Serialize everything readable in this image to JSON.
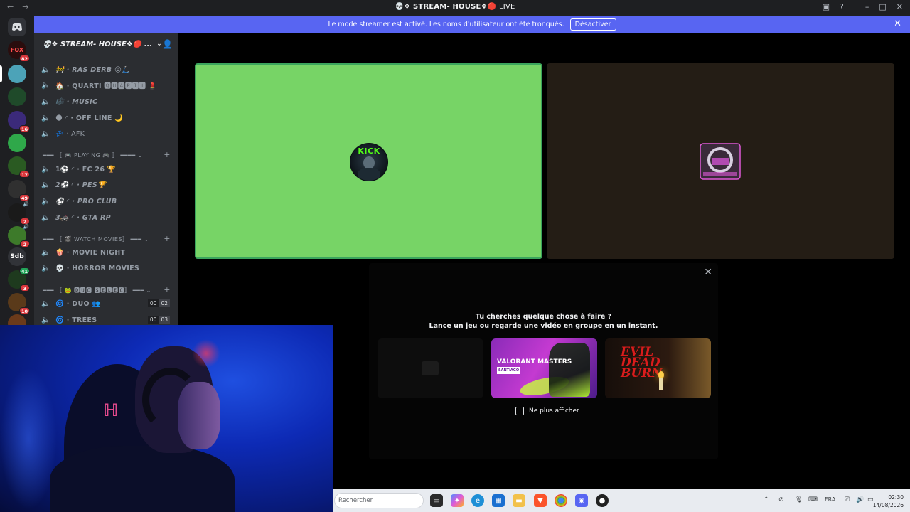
{
  "titlebar": {
    "back": "←",
    "forward": "→",
    "title": "💀❖ STREAM- HOUSE❖🔴",
    "live": "LIVE",
    "icons": [
      "inbox-icon",
      "help-icon",
      "minimize-icon",
      "maximize-icon",
      "close-icon"
    ]
  },
  "banner": {
    "message": "Le mode streamer est activé. Les noms d'utilisateur ont été tronqués.",
    "button": "Désactiver",
    "close": "✕"
  },
  "rail": {
    "servers": [
      {
        "label": "FOX",
        "badge": "82"
      },
      {
        "label": "",
        "badge": ""
      },
      {
        "label": "",
        "badge": ""
      },
      {
        "label": "",
        "badge": "16"
      },
      {
        "label": "",
        "badge": ""
      },
      {
        "label": "",
        "badge": "17"
      },
      {
        "label": "",
        "badge": "49"
      },
      {
        "label": "",
        "badge": "2"
      },
      {
        "label": "",
        "badge": "2"
      },
      {
        "label": "Sdb",
        "badge": ""
      },
      {
        "label": "",
        "badge": "3"
      },
      {
        "label": "",
        "badge": "10"
      }
    ],
    "extra_badge": "41"
  },
  "sidebar": {
    "guild_name": "💀❖ STREAM- HOUSE❖🔴 ...",
    "channels_top": [
      {
        "label": "🚧 · RAS DERB 😵🛴"
      },
      {
        "label": "🏠 · QUARTI 🆀🆄🅰🆁🆃🅸 💄"
      },
      {
        "label": "🎼 · MUSIC"
      },
      {
        "label": "🌑 ◜ · OFF LINE 🌙"
      },
      {
        "label": "💤 · AFK"
      }
    ],
    "cat_playing": "━━━ 〚 🎮 PLAYING 🎮 〛 ━━━━ ⌄",
    "channels_playing": [
      {
        "label": "1⚽ ◜ · FC 26 🏆"
      },
      {
        "label": "2⚽ ◜ · PES🏆"
      },
      {
        "label": "⚽ ◜ · PRO CLUB"
      },
      {
        "label": "3🚓 ◜ · GTA RP"
      }
    ],
    "cat_movies": "━━━ 〚 🎬 WATCH MOVIES〛 ━━━ ⌄",
    "channels_movies": [
      {
        "label": "🍿 · MOVIE NIGHT"
      },
      {
        "label": "💀 · HORROR MOVIES"
      }
    ],
    "cat_duo": "━━━ 〚 🐸 🅳🆄🅾 🆂🅴🅻🅴🅲〛 ━━━ ⌄",
    "channels_duo": [
      {
        "label": "🌀 · DUO 👥",
        "cnt_a": "00",
        "cnt_b": "02"
      },
      {
        "label": "🌀 · TREES",
        "cnt_a": "00",
        "cnt_b": "03"
      }
    ]
  },
  "tiles": {
    "tile1_avatar_text": "KICK",
    "tile1_color": "#77d466",
    "tile2_color": "#241d15"
  },
  "activity": {
    "question": "Tu cherches quelque chose à faire ?",
    "subtitle": "Lance un jeu ou regarde une vidéo en groupe en un instant.",
    "card2_title": "VALORANT MASTERS",
    "card2_sub": "SANTIAGO",
    "card3_title": "EVIL DEAD BURN",
    "checkbox_label": "Ne plus afficher"
  },
  "taskbar": {
    "search_placeholder": "Rechercher",
    "lang": "FRA",
    "time": "02:30",
    "date": "14/08/2026"
  }
}
